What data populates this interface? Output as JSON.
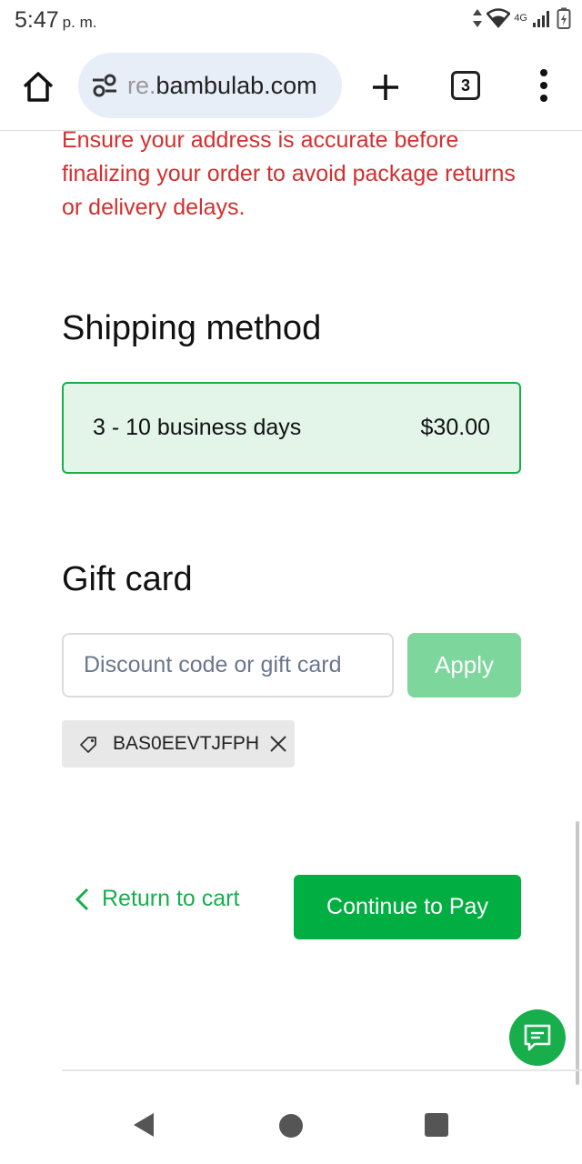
{
  "status_bar": {
    "time": "5:47",
    "ampm": "p. m.",
    "network": "4G"
  },
  "browser": {
    "url_prefix": "re.",
    "url_domain": "bambulab.com",
    "tab_count": "3"
  },
  "page": {
    "warning_text": "Ensure your address is accurate before finalizing your order to avoid package returns or delivery delays.",
    "shipping": {
      "title": "Shipping method",
      "option_label": "3 - 10 business days",
      "option_price": "$30.00"
    },
    "gift_card": {
      "title": "Gift card",
      "input_placeholder": "Discount code or gift card",
      "apply_label": "Apply",
      "applied_code": "BAS0EEVTJFPH"
    },
    "actions": {
      "return_label": "Return to cart",
      "continue_label": "Continue to Pay"
    }
  },
  "colors": {
    "accent_green": "#00ae42",
    "warning_red": "#d32f2f",
    "selected_bg": "#e3f5e9"
  },
  "icons": [
    "home-icon",
    "tune-icon",
    "plus-icon",
    "more-vert-icon",
    "tag-icon",
    "close-icon",
    "chevron-left-icon",
    "chat-icon",
    "back-triangle-icon"
  ]
}
